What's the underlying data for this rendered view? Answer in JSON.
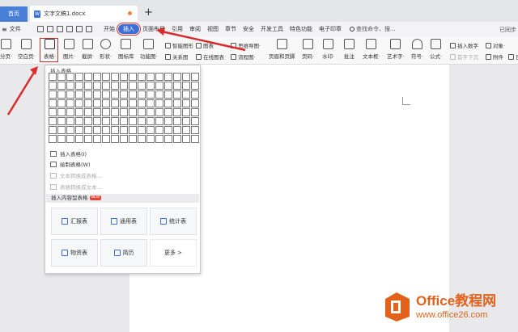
{
  "tabs": {
    "home": "首页",
    "doc": "文字文稿1.docx",
    "add": "+"
  },
  "menubar": {
    "file": "文件",
    "items": [
      "开始",
      "插入",
      "页面布局",
      "引用",
      "审阅",
      "视图",
      "章节",
      "安全",
      "开发工具",
      "特色功能",
      "电子印章"
    ],
    "active": "插入",
    "search": "查找命令、搜...",
    "sync": "已同步"
  },
  "ribbon": {
    "big": [
      {
        "id": "page-break",
        "label": "分页·"
      },
      {
        "id": "blank-page",
        "label": "空白页·"
      },
      {
        "id": "table",
        "label": "表格·"
      },
      {
        "id": "picture",
        "label": "图片·"
      },
      {
        "id": "screenshot",
        "label": "截屏·"
      },
      {
        "id": "shape",
        "label": "形状·"
      },
      {
        "id": "icon-lib",
        "label": "图标库"
      },
      {
        "id": "func-chart",
        "label": "功能图·"
      }
    ],
    "small": {
      "smart_graphic": "智能图形",
      "chart": "图表",
      "mind_map": "思维导图·",
      "relation": "关系图",
      "online_chart": "在线图表",
      "flowchart": "流程图·",
      "header_footer": "页眉和页脚",
      "page_number": "页码·",
      "watermark": "水印·",
      "comment": "批注",
      "textbox": "文本框·",
      "art_text": "艺术字·",
      "symbol": "符号·",
      "formula": "公式·",
      "insert_number": "插入数字",
      "object": "对象·",
      "first_char": "首字下沉",
      "attachment": "附件",
      "date": "日期"
    }
  },
  "dropdown": {
    "title": "插入表格",
    "items": {
      "insert_table": "插入表格(I)",
      "draw_table": "绘制表格(W)",
      "text_to_table": "文本转换成表格...",
      "table_to_text": "表格转换成文本..."
    },
    "section": "插入内容型表格",
    "badge": "NEW",
    "cards": [
      "汇报表",
      "通用表",
      "统计表",
      "物资表",
      "简历",
      "更多 >"
    ]
  },
  "watermark": {
    "brand": "Office教程网",
    "url": "www.office26.com"
  },
  "colors": {
    "accent": "#3b6fd6",
    "highlight": "#d92c2c",
    "brand": "#e2621b"
  }
}
